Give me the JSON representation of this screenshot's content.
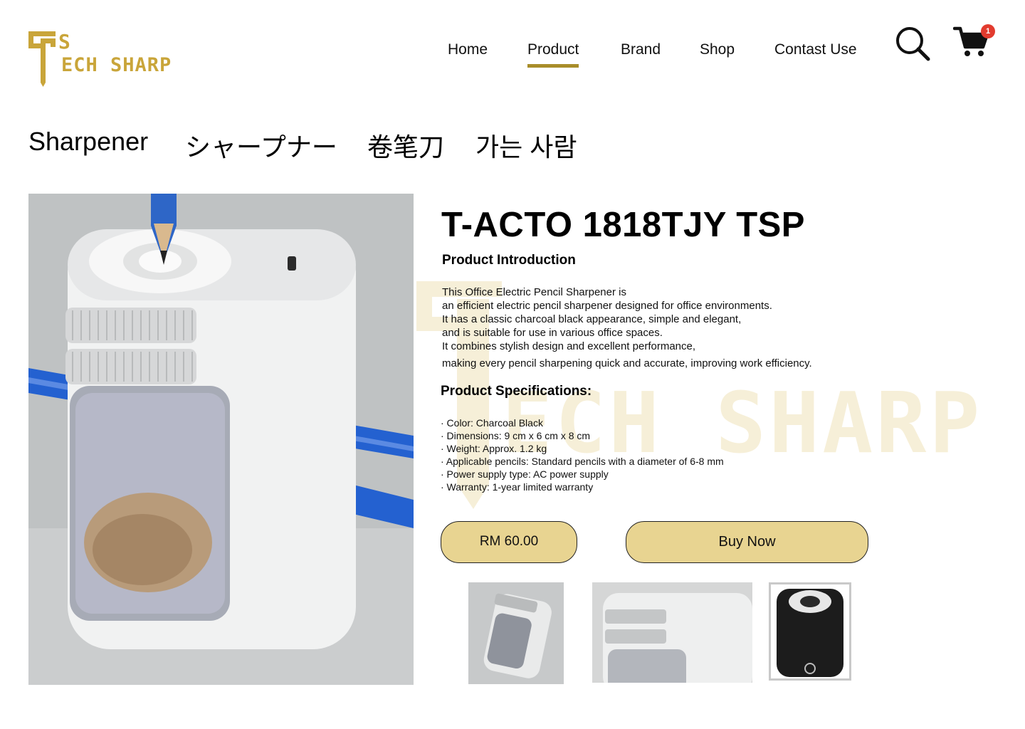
{
  "brand": {
    "logo_text": "ECH SHARP",
    "logo_icon": "ts-pencil-logo",
    "color": "#c9a53a"
  },
  "nav": {
    "items": [
      {
        "label": "Home",
        "active": false
      },
      {
        "label": "Product",
        "active": true
      },
      {
        "label": "Brand",
        "active": false
      },
      {
        "label": "Shop",
        "active": false
      },
      {
        "label": "Contast Use",
        "active": false
      }
    ],
    "active_underline_color": "#a88d2a"
  },
  "header_actions": {
    "search_icon": "search-icon",
    "cart_icon": "cart-icon",
    "cart_count": "1"
  },
  "categories": [
    "Sharpener",
    "シャープナー",
    "卷笔刀",
    "가는 사람"
  ],
  "product": {
    "title": "T-ACTO 1818TJY TSP",
    "intro_heading": "Product Introduction",
    "intro_lines": [
      "This Office Electric Pencil Sharpener is",
      "an efficient electric pencil sharpener designed for office environments.",
      "It has a classic charcoal black appearance, simple and elegant,",
      "and is suitable for use in various office spaces.",
      "It combines stylish design and excellent performance,",
      "making every pencil sharpening quick and accurate, improving work efficiency."
    ],
    "spec_heading": "Product Specifications:",
    "specs": [
      "· Color: Charcoal Black",
      "· Dimensions: 9 cm x 6 cm x 8 cm",
      "· Weight: Approx. 1.2 kg",
      "· Applicable pencils: Standard pencils with a diameter of 6-8 mm",
      "· Power supply type: AC power supply",
      "· Warranty: 1-year limited warranty"
    ],
    "price": "RM 60.00",
    "buy_label": "Buy Now",
    "button_color": "#e8d491"
  },
  "watermark_text": "ECH SHARP"
}
